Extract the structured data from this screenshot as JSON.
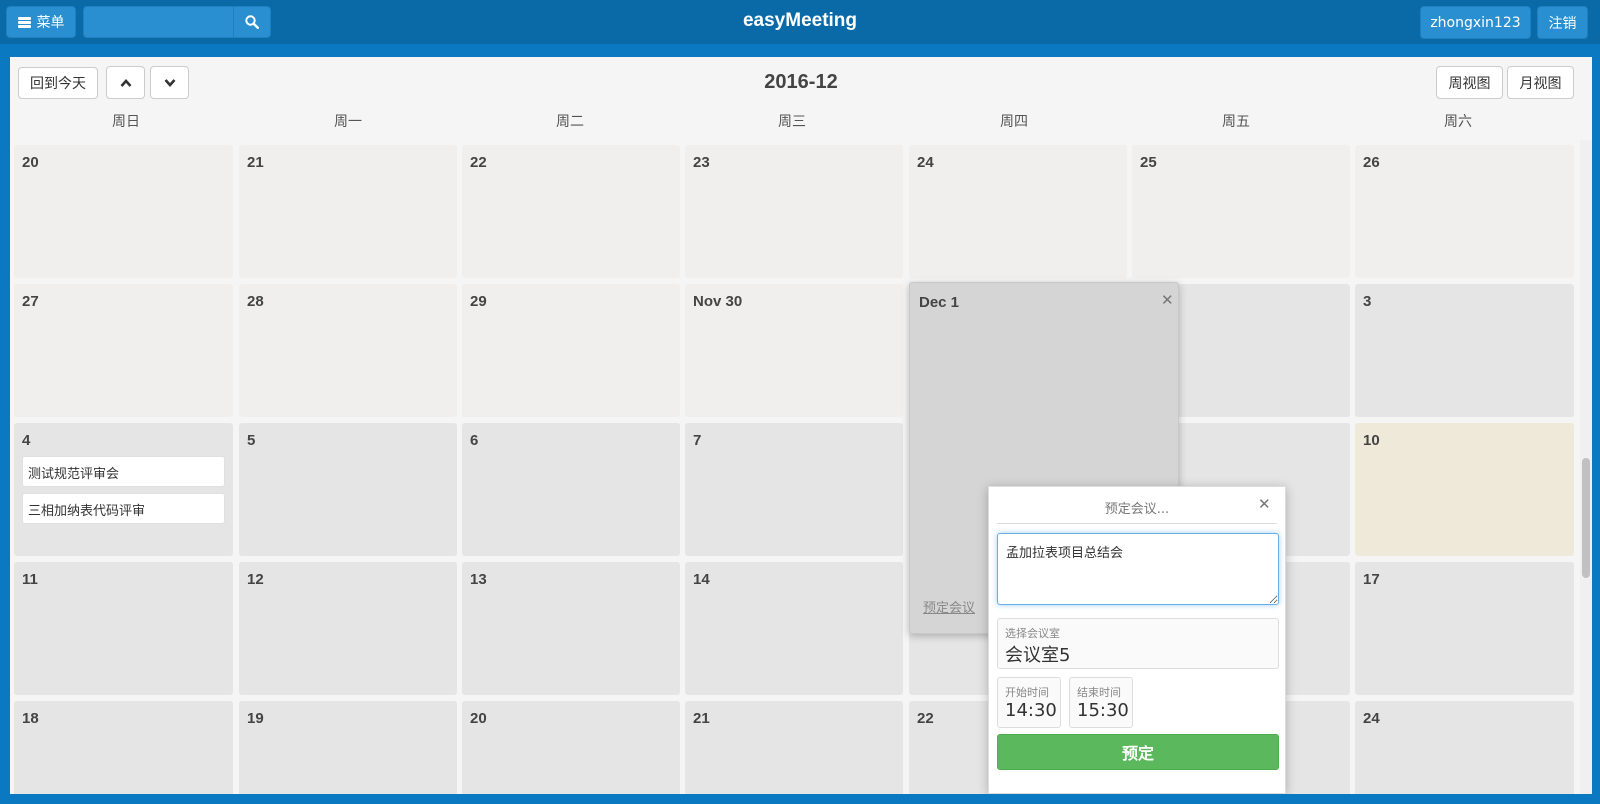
{
  "navbar": {
    "menu_label": "菜单",
    "search_value": "",
    "title": "easyMeeting",
    "user": "zhongxin123",
    "logout": "注销"
  },
  "calendar": {
    "today_btn": "回到今天",
    "title": "2016-12",
    "week_view": "周视图",
    "month_view": "月视图",
    "weekdays": [
      "周日",
      "周一",
      "周二",
      "周三",
      "周四",
      "周五",
      "周六"
    ],
    "weeks": [
      [
        "20",
        "21",
        "22",
        "23",
        "24",
        "25",
        "26"
      ],
      [
        "27",
        "28",
        "29",
        "Nov 30",
        "Dec 1",
        "",
        "3"
      ],
      [
        "4",
        "5",
        "6",
        "7",
        "",
        "",
        "10"
      ],
      [
        "11",
        "12",
        "13",
        "14",
        "",
        "",
        "17"
      ],
      [
        "18",
        "19",
        "20",
        "21",
        "22",
        "",
        "24"
      ]
    ],
    "events": {
      "e1": "测试规范评审会",
      "e2": "三相加纳表代码评审"
    },
    "expanded_day": {
      "label": "Dec 1",
      "book_link": "预定会议"
    }
  },
  "booking_popup": {
    "title": "预定会议...",
    "meeting_text": "孟加拉表项目总结会",
    "room_label": "选择会议室",
    "room_value": "会议室5",
    "start_label": "开始时间",
    "start_value": "14:30",
    "end_label": "结束时间",
    "end_value": "15:30",
    "submit": "预定"
  },
  "colors": {
    "nav_bg": "#0a6aa8",
    "page_bg": "#0b78c2",
    "today_bg": "#efe9d9",
    "book_btn": "#5cb85c"
  }
}
